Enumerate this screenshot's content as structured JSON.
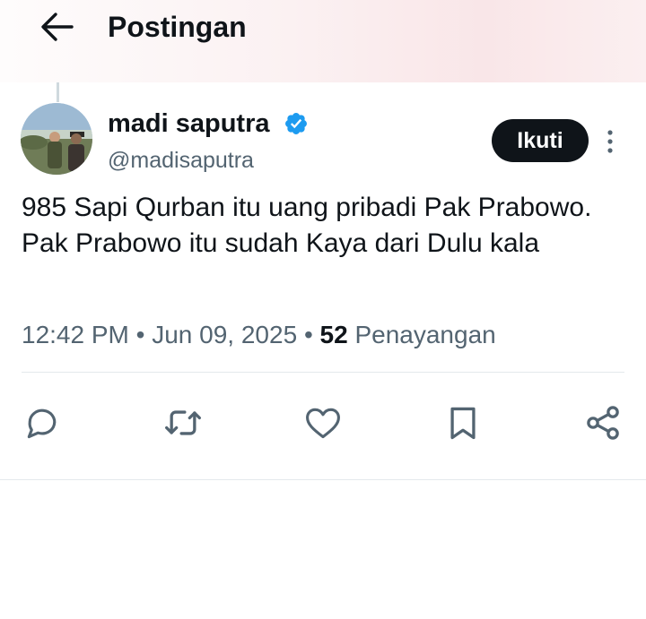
{
  "header": {
    "title": "Postingan",
    "back_icon": "arrow-left-icon"
  },
  "post": {
    "author": {
      "name": "madi saputra",
      "handle": "@madisaputra",
      "verified_icon": "verified-badge-icon",
      "verified_color": "#1d9bf0"
    },
    "follow_label": "Ikuti",
    "more_icon": "more-vertical-icon",
    "text": "985 Sapi Qurban itu uang pribadi Pak Prabowo. Pak Prabowo itu sudah Kaya dari Dulu kala",
    "time": "12:42 PM",
    "date": "Jun 09, 2025",
    "separator": "•",
    "views_count": "52",
    "views_label": "Penayangan"
  },
  "actions": [
    {
      "icon": "reply-icon"
    },
    {
      "icon": "repost-icon"
    },
    {
      "icon": "like-icon"
    },
    {
      "icon": "bookmark-icon"
    },
    {
      "icon": "share-icon"
    }
  ],
  "colors": {
    "text_primary": "#0f1419",
    "text_secondary": "#536471",
    "icon_color": "#536471",
    "follow_button_bg": "#0f1419",
    "divider": "#e4e9ec"
  }
}
